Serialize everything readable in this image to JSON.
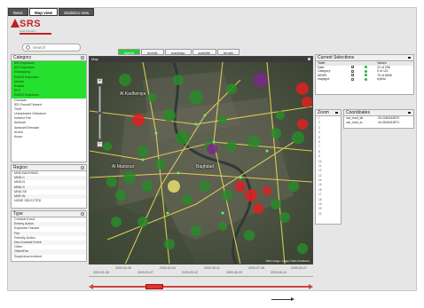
{
  "tabs": [
    {
      "label": "Basic"
    },
    {
      "label": "Map view"
    },
    {
      "label": "Statistics view"
    }
  ],
  "logo": {
    "text": "SRS",
    "subtitle": "Real Situation"
  },
  "search": {
    "placeholder": "Search"
  },
  "map_types": [
    {
      "label": "hybrid",
      "active": true
    },
    {
      "label": "mobile",
      "active": false
    },
    {
      "label": "roadmap",
      "active": false
    },
    {
      "label": "satellite",
      "active": false
    },
    {
      "label": "terrain",
      "active": false
    }
  ],
  "category": {
    "title": "Category",
    "items": [
      {
        "label": "IED Explosion",
        "on": true
      },
      {
        "label": "IED Explosion",
        "on": true
      },
      {
        "label": "Kidnapping",
        "on": true
      },
      {
        "label": "RAIDS Explosion",
        "on": true
      },
      {
        "label": "Murder",
        "on": true
      },
      {
        "label": "Rocket",
        "on": true
      },
      {
        "label": "EFS",
        "on": true
      },
      {
        "label": "RAIDS Explosion",
        "on": true
      },
      {
        "label": "Grenade",
        "on": false
      },
      {
        "label": "IED Found/Cleared",
        "on": false
      },
      {
        "label": "Theft",
        "on": false
      },
      {
        "label": "Unexploded Ordnance",
        "on": false
      },
      {
        "label": "Indirect Fire",
        "on": false
      },
      {
        "label": "Ambush",
        "on": false
      },
      {
        "label": "Ambush/Grenade",
        "on": false
      },
      {
        "label": "Arrest",
        "on": false
      },
      {
        "label": "Arson",
        "on": false
      }
    ]
  },
  "region": {
    "title": "Region",
    "items": [
      "MND-BAGHDAD",
      "MND-C",
      "MND-N",
      "MND-S",
      "MND-SE",
      "MNF-W",
      "NONE SELECTED"
    ]
  },
  "type": {
    "title": "Type",
    "items": [
      "Criminal Event",
      "Enemy Action",
      "Explosive Hazard",
      "Fire",
      "Friendly Action",
      "Non-Combat Event",
      "Other",
      "Other/Fire",
      "Suspicious Incident"
    ]
  },
  "map": {
    "header": "Map",
    "cities": [
      "Al Kadhimiya",
      "Baghdad",
      "Al Mansour"
    ],
    "copyright": "©2011 Google · Imagery ©2011 TerraMetrics"
  },
  "current_selections": {
    "title": "Current Selections",
    "columns": [
      "Table",
      "",
      "",
      "Values"
    ],
    "rows": [
      {
        "table": "Date",
        "value": "31 of 296"
      },
      {
        "table": "Category",
        "value": "9 of 121"
      },
      {
        "table": "MGRS",
        "value": "75 of 6845"
      },
      {
        "table": "maptype",
        "value": "hybrid"
      }
    ]
  },
  "zoom_panel": {
    "title": "Zoom",
    "levels": [
      "1",
      "2",
      "3",
      "4",
      "5",
      "6",
      "7",
      "8",
      "9",
      "10",
      "11",
      "12",
      "13",
      "14",
      "15",
      "16",
      "17",
      "18",
      "19",
      "20",
      "21"
    ]
  },
  "coordinates": {
    "title": "Coordinates",
    "rows": [
      {
        "label": "var_mod_lat",
        "value": "33.2280162870"
      },
      {
        "label": "var_mod_lo..",
        "value": "44.3543012871"
      }
    ]
  },
  "timeline": {
    "upper": [
      "2009-02-06",
      "2009-04-04",
      "2009-05-31",
      "2009-07-28",
      "2009-09-21"
    ],
    "lower": [
      "2009-01-08",
      "2009-03-07",
      "2009-05-02",
      "2009-06-29",
      "2009-08-24"
    ]
  },
  "colors": {
    "active_green": "#25e02e",
    "marker_green": "#2a8a2a",
    "marker_red": "#e02020",
    "marker_purple": "#7a2a8a",
    "marker_yellow": "#e6e06a",
    "road_yellow": "#e6d65a"
  }
}
